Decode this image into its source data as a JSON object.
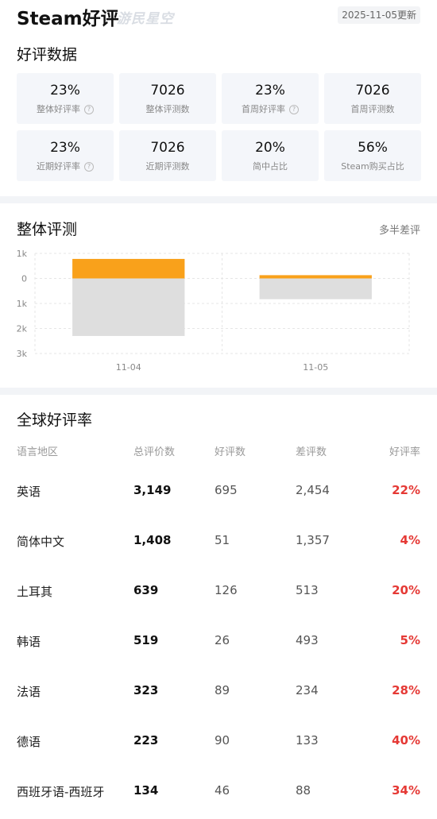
{
  "header": {
    "title": "Steam好评",
    "brand": "游民星空",
    "update_date": "2025-11-05更新"
  },
  "sections": {
    "stats_title": "好评数据",
    "chart_title": "整体评测",
    "verdict": "多半差评",
    "global_title": "全球好评率"
  },
  "stats": [
    {
      "value": "23%",
      "label": "整体好评率",
      "help": true
    },
    {
      "value": "7026",
      "label": "整体评测数",
      "help": false
    },
    {
      "value": "23%",
      "label": "首周好评率",
      "help": true
    },
    {
      "value": "7026",
      "label": "首周评测数",
      "help": false
    },
    {
      "value": "23%",
      "label": "近期好评率",
      "help": true
    },
    {
      "value": "7026",
      "label": "近期评测数",
      "help": false
    },
    {
      "value": "20%",
      "label": "简中占比",
      "help": false
    },
    {
      "value": "56%",
      "label": "Steam购买占比",
      "help": false
    }
  ],
  "icons": {
    "help": "?"
  },
  "chart_data": {
    "type": "bar",
    "categories": [
      "11-04",
      "11-05"
    ],
    "series": [
      {
        "name": "",
        "color": "#f9a11b",
        "values": [
          780,
          130
        ]
      },
      {
        "name": "",
        "color": "#dedede",
        "values": [
          -2300,
          -830
        ]
      }
    ],
    "ylim": [
      -3000,
      1000
    ],
    "yticks": [
      1000,
      0,
      -1000,
      -2000,
      -3000
    ],
    "ytick_labels": [
      "1k",
      "0",
      "1k",
      "2k",
      "3k"
    ],
    "grid": true
  },
  "table": {
    "headers": {
      "lang": "语言地区",
      "total": "总评价数",
      "pos": "好评数",
      "neg": "差评数",
      "rate": "好评率"
    },
    "rows": [
      {
        "lang": "英语",
        "total": "3,149",
        "pos": "695",
        "neg": "2,454",
        "rate": "22%"
      },
      {
        "lang": "简体中文",
        "total": "1,408",
        "pos": "51",
        "neg": "1,357",
        "rate": "4%"
      },
      {
        "lang": "土耳其",
        "total": "639",
        "pos": "126",
        "neg": "513",
        "rate": "20%"
      },
      {
        "lang": "韩语",
        "total": "519",
        "pos": "26",
        "neg": "493",
        "rate": "5%"
      },
      {
        "lang": "法语",
        "total": "323",
        "pos": "89",
        "neg": "234",
        "rate": "28%"
      },
      {
        "lang": "德语",
        "total": "223",
        "pos": "90",
        "neg": "133",
        "rate": "40%"
      },
      {
        "lang": "西班牙语-西班牙",
        "total": "134",
        "pos": "46",
        "neg": "88",
        "rate": "34%"
      }
    ]
  }
}
